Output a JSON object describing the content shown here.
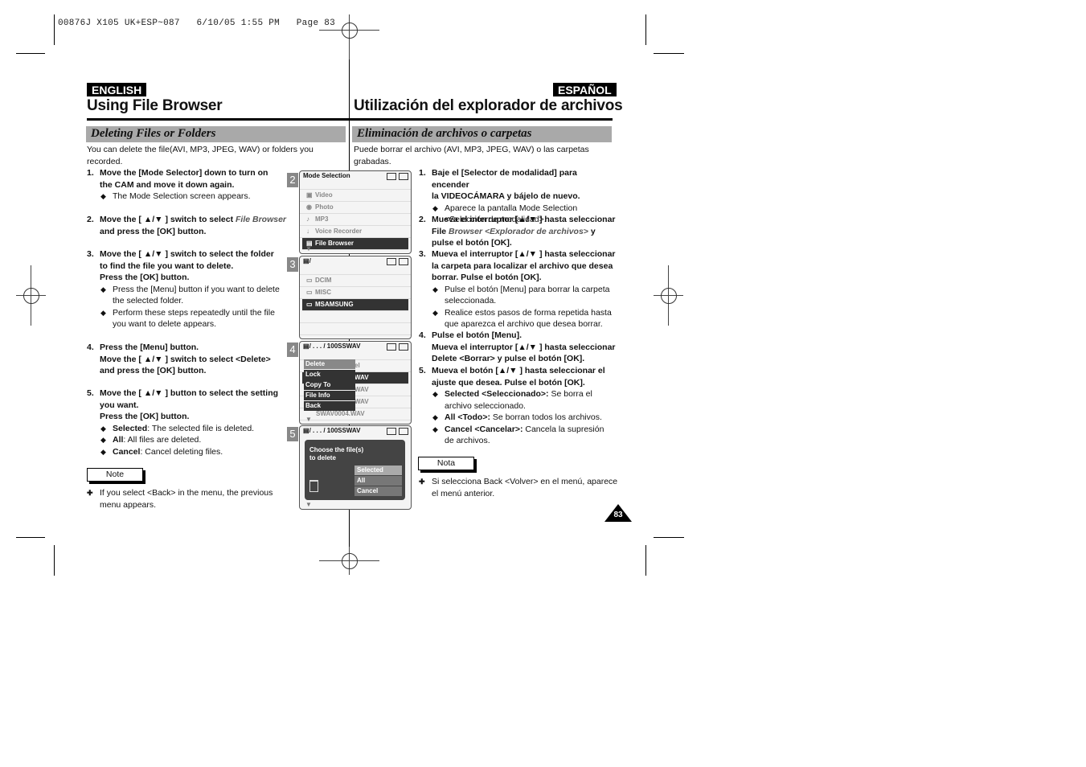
{
  "slug": "00876J X105 UK+ESP~087   6/10/05 1:55 PM   Page 83",
  "english": {
    "badge": "ENGLISH",
    "title": "Using File Browser",
    "section": "Deleting Files or Folders",
    "intro": "You can delete the file(AVI, MP3, JPEG, WAV) or folders you recorded.",
    "steps": [
      {
        "num": "1.",
        "lines": [
          "Move the [Mode Selector] down to turn on",
          "the CAM and move it down again."
        ],
        "bullets": [
          "The Mode Selection screen appears."
        ]
      },
      {
        "num": "2.",
        "pre": "Move the [ ▲/▼ ] switch to select ",
        "italic": "File Browser",
        "post": "and press the [OK] button."
      },
      {
        "num": "3.",
        "lines": [
          "Move the [ ▲/▼ ] switch to select the folder",
          "to find the file you want to delete.",
          "Press the [OK] button."
        ],
        "bullets": [
          "Press the [Menu] button if you want to delete the selected folder.",
          "Perform these steps repeatedly until the file you want to delete appears."
        ]
      },
      {
        "num": "4.",
        "lines": [
          "Press the [Menu] button.",
          "Move the [ ▲/▼ ] switch to select <Delete>",
          "and press the [OK] button."
        ]
      },
      {
        "num": "5.",
        "lines": [
          "Move the [ ▲/▼ ] button to select the setting",
          "you want.",
          "Press the [OK] button."
        ],
        "bullets_rich": [
          {
            "b": "Selected",
            "t": ": The selected file is deleted."
          },
          {
            "b": "All",
            "t": ": All files are deleted."
          },
          {
            "b": "Cancel",
            "t": ": Cancel deleting files."
          }
        ]
      }
    ],
    "note_label": "Note",
    "note_symbol": "✚",
    "note_text": "If you select <Back> in the menu, the previous menu appears."
  },
  "espanol": {
    "badge": "ESPAÑOL",
    "title": "Utilización del explorador de archivos",
    "section": "Eliminación de archivos o carpetas",
    "intro": "Puede borrar el archivo (AVI, MP3, JPEG, WAV) o las carpetas grabadas.",
    "steps": [
      {
        "num": "1.",
        "lines": [
          "Baje el [Selector de modalidad] para encender",
          "la VIDEOCÁMARA y bájelo de nuevo."
        ],
        "bullets": [
          "Aparece la pantalla Mode Selection <Selección de modalidad>."
        ]
      },
      {
        "num": "2.",
        "line1": "Mueva el interruptor [▲/▼ ] hasta seleccionar",
        "pre": "File ",
        "italic": "Browser <Explorador de archivos>",
        "post": " y",
        "line3": "pulse el botón [OK]."
      },
      {
        "num": "3.",
        "lines": [
          "Mueva el interruptor [▲/▼ ] hasta seleccionar",
          "la carpeta para localizar el archivo que desea",
          "borrar. Pulse el botón [OK]."
        ],
        "bullets": [
          "Pulse el botón [Menu] para borrar la carpeta seleccionada.",
          "Realice estos pasos de forma repetida hasta que aparezca el archivo que desea borrar."
        ]
      },
      {
        "num": "4.",
        "lines": [
          "Pulse el botón [Menu].",
          "Mueva el interruptor [▲/▼ ] hasta seleccionar",
          "Delete <Borrar> y pulse el botón [OK]."
        ]
      },
      {
        "num": "5.",
        "lines": [
          "Mueva el botón [▲/▼ ] hasta seleccionar el",
          "ajuste que desea. Pulse el botón [OK]."
        ],
        "bullets_rich": [
          {
            "b": "Selected <Seleccionado>:",
            "t": " Se borra el archivo seleccionado."
          },
          {
            "b": "All <Todo>:",
            "t": " Se borran todos los archivos."
          },
          {
            "b": "Cancel <Cancelar>:",
            "t": " Cancela la supresión de archivos."
          }
        ]
      }
    ],
    "note_label": "Nota",
    "note_symbol": "✚",
    "note_text": "Si selecciona Back <Volver> en el menú, aparece el menú anterior."
  },
  "screens": {
    "s2": {
      "num": "2",
      "title": "Mode Selection",
      "items": [
        {
          "icon": "video-camera-icon",
          "glyph": "▣",
          "label": "Video"
        },
        {
          "icon": "camera-icon",
          "glyph": "◉",
          "label": "Photo"
        },
        {
          "icon": "music-note-icon",
          "glyph": "♪",
          "label": "MP3"
        },
        {
          "icon": "microphone-icon",
          "glyph": "↓",
          "label": "Voice Recorder"
        },
        {
          "icon": "file-browser-icon",
          "glyph": "▤",
          "label": "File Browser",
          "selected": true
        }
      ]
    },
    "s3": {
      "num": "3",
      "path": "/",
      "items": [
        {
          "label": "DCIM"
        },
        {
          "label": "MISC"
        },
        {
          "label": "MSAMSUNG",
          "selected": true
        }
      ]
    },
    "s4": {
      "num": "4",
      "path": "/ . . . / 100SSWAV",
      "behind": [
        "el",
        "WAV",
        "WAV",
        "WAV",
        "SWAV0004.WAV"
      ],
      "menu": [
        "Delete",
        "Lock",
        "Copy To",
        "File Info",
        "Back"
      ]
    },
    "s5": {
      "num": "5",
      "path": "/ . . . / 100SSWAV",
      "prompt_line1": "Choose the file(s)",
      "prompt_line2": "to delete",
      "options": [
        "Selected",
        "All",
        "Cancel"
      ]
    }
  },
  "page_number": "83"
}
